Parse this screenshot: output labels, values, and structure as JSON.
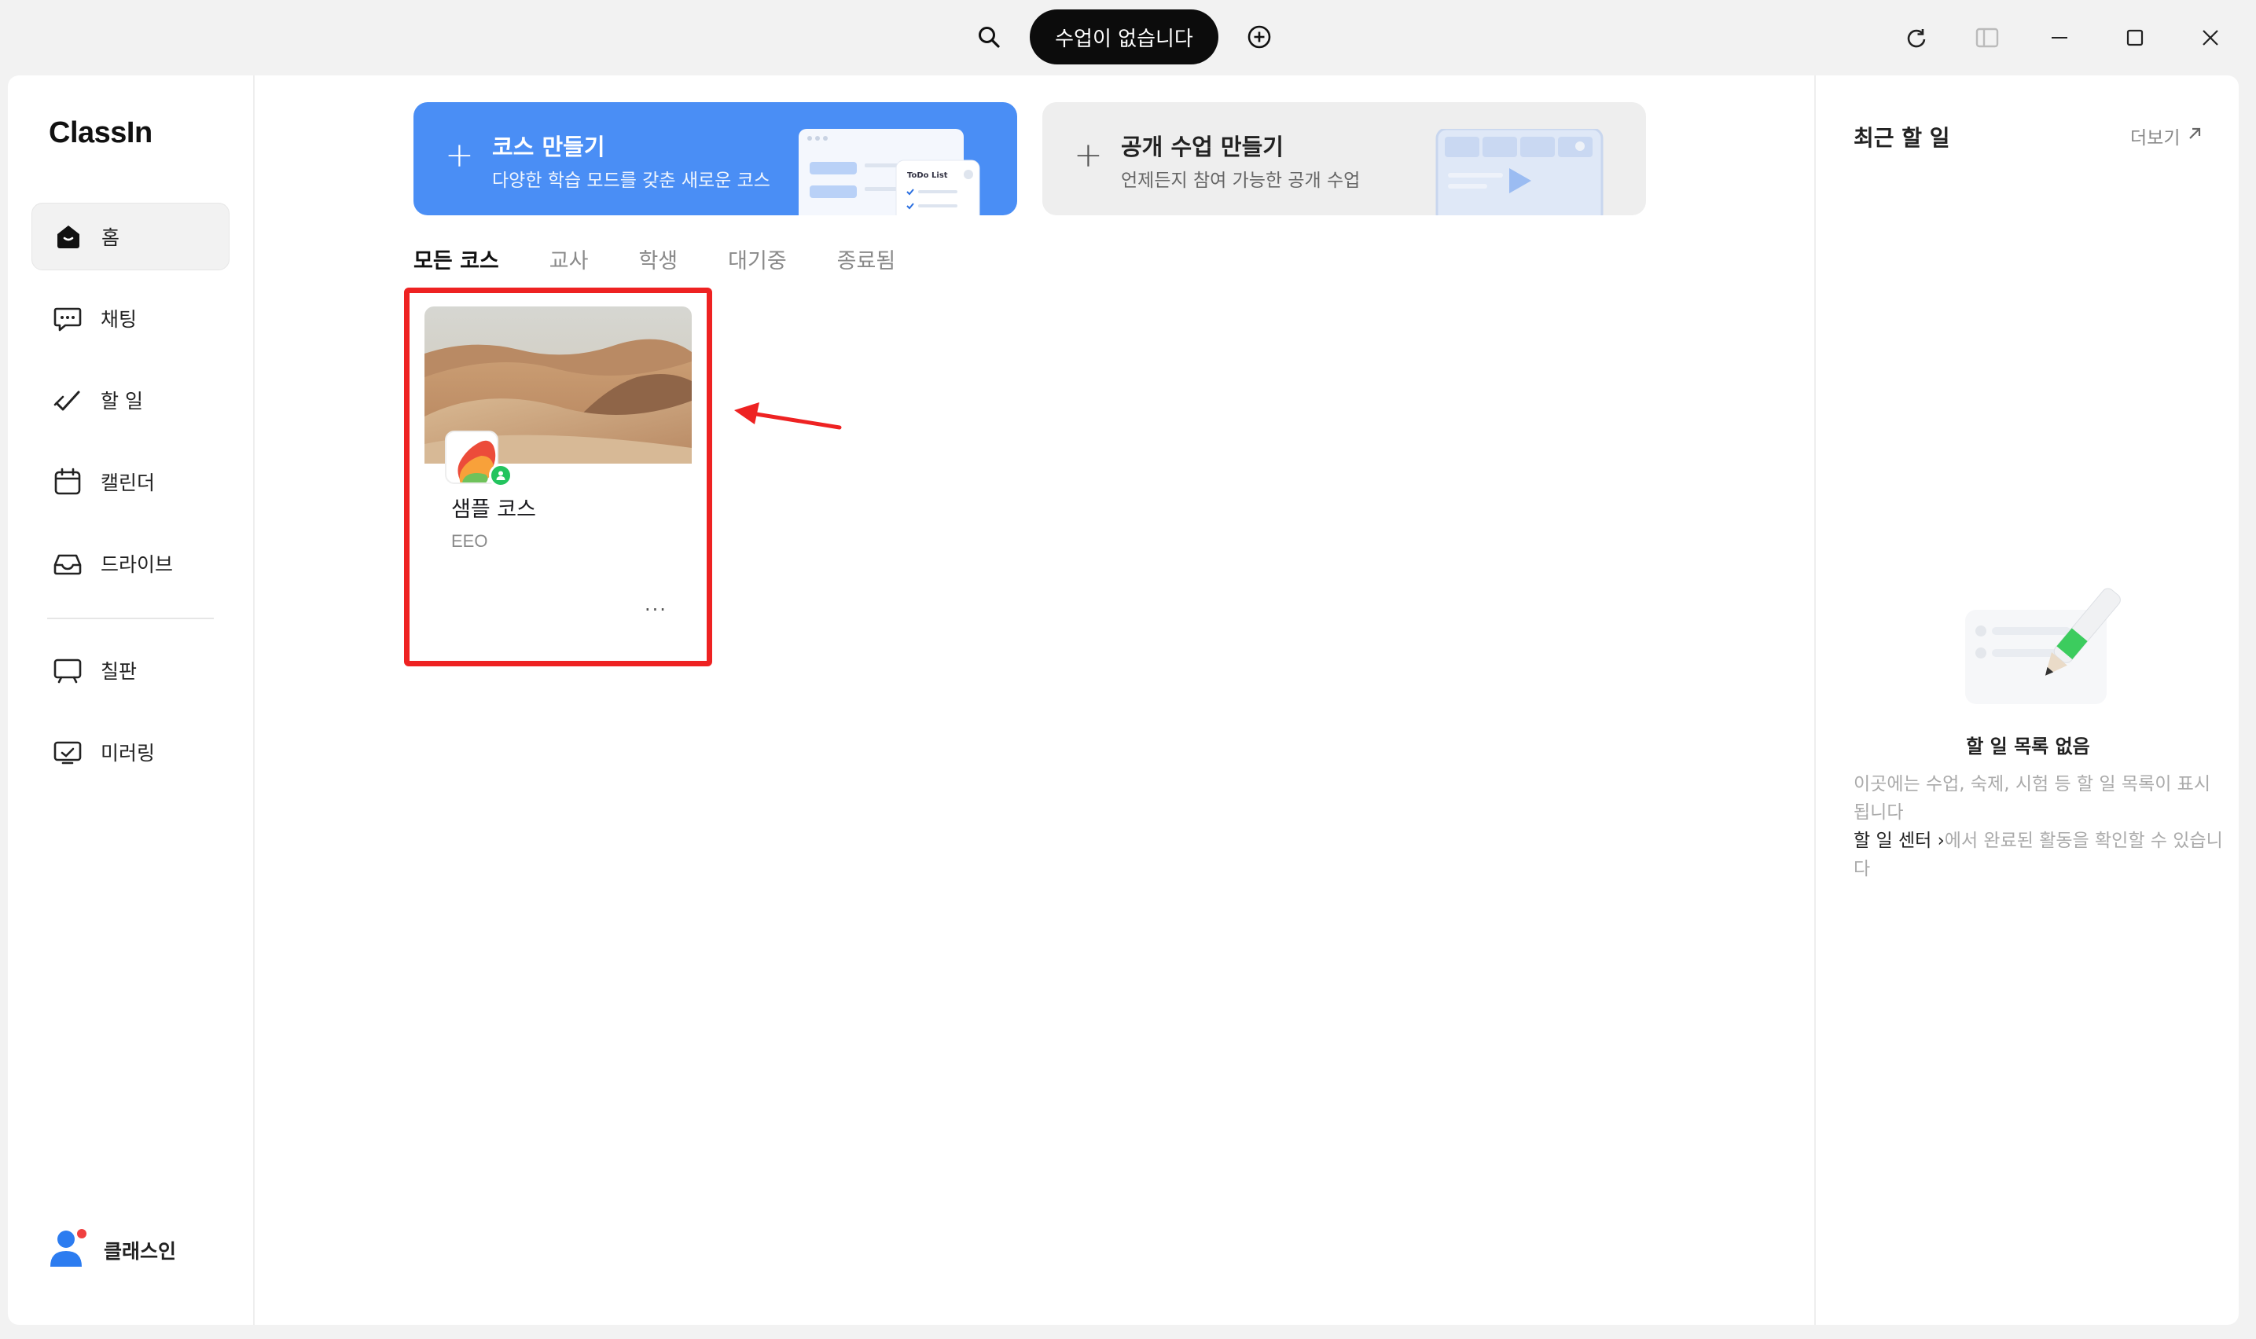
{
  "titlebar": {
    "lesson_status": "수업이 없습니다",
    "icons": [
      "search-icon",
      "add-circle-icon",
      "refresh-icon",
      "sidebar-toggle-icon",
      "minimize-icon",
      "maximize-icon",
      "close-icon"
    ]
  },
  "sidebar": {
    "logo": "ClassIn",
    "items": [
      {
        "label": "홈",
        "icon": "home-icon",
        "active": true
      },
      {
        "label": "채팅",
        "icon": "chat-icon"
      },
      {
        "label": "할 일",
        "icon": "todo-icon"
      },
      {
        "label": "캘린더",
        "icon": "calendar-icon"
      },
      {
        "label": "드라이브",
        "icon": "drive-icon"
      },
      {
        "label": "칠판",
        "icon": "blackboard-icon"
      },
      {
        "label": "미러링",
        "icon": "mirroring-icon"
      }
    ],
    "user": {
      "name": "클래스인"
    }
  },
  "main": {
    "create_course": {
      "title": "코스 만들기",
      "subtitle": "다양한 학습 모드를 갖춘 새로운 코스",
      "illus_text": "ToDo List"
    },
    "create_public": {
      "title": "공개 수업 만들기",
      "subtitle": "언제든지 참여 가능한 공개 수업"
    },
    "tabs": [
      {
        "label": "모든 코스",
        "active": true
      },
      {
        "label": "교사"
      },
      {
        "label": "학생"
      },
      {
        "label": "대기중"
      },
      {
        "label": "종료됨"
      }
    ],
    "courses": [
      {
        "title": "샘플 코스",
        "teacher": "EEO",
        "more": "···"
      }
    ]
  },
  "right_panel": {
    "title": "최근 할 일",
    "more": "더보기",
    "empty_title": "할 일 목록 없음",
    "empty_desc_1": "이곳에는 수업, 숙제, 시험 등 할 일 목록이 표시됩니다",
    "empty_link": "할 일 센터",
    "empty_desc_2": "에서 완료된 활동을 확인할 수 있습니다"
  },
  "colors": {
    "accent": "#4a8ef5",
    "highlight": "#ee2222",
    "badge": "#23c45e"
  }
}
